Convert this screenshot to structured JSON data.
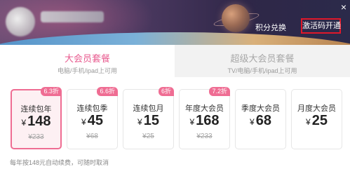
{
  "header": {
    "points_exchange": "积分兑换",
    "activation_code": "激活码开通",
    "close": "×"
  },
  "tabs": [
    {
      "title": "大会员套餐",
      "subtitle": "电脑/手机/ipad上可用",
      "active": true
    },
    {
      "title": "超级大会员套餐",
      "subtitle": "TV/电脑/手机/ipad上可用",
      "active": false
    }
  ],
  "packages": [
    {
      "name": "连续包年",
      "currency": "¥",
      "price": "148",
      "original": "¥233",
      "badge": "6.3折",
      "selected": true
    },
    {
      "name": "连续包季",
      "currency": "¥",
      "price": "45",
      "original": "¥68",
      "badge": "6.6折",
      "selected": false
    },
    {
      "name": "连续包月",
      "currency": "¥",
      "price": "15",
      "original": "¥25",
      "badge": "6折",
      "selected": false
    },
    {
      "name": "年度大会员",
      "currency": "¥",
      "price": "168",
      "original": "¥233",
      "badge": "7.2折",
      "selected": false
    },
    {
      "name": "季度大会员",
      "currency": "¥",
      "price": "68",
      "original": "",
      "badge": "",
      "selected": false
    },
    {
      "name": "月度大会员",
      "currency": "¥",
      "price": "25",
      "original": "",
      "badge": "",
      "selected": false
    }
  ],
  "footer_note": "每年按148元自动续费，可随时取消",
  "colors": {
    "accent_pink": "#ef6d93",
    "activation_border": "#e0182a"
  }
}
